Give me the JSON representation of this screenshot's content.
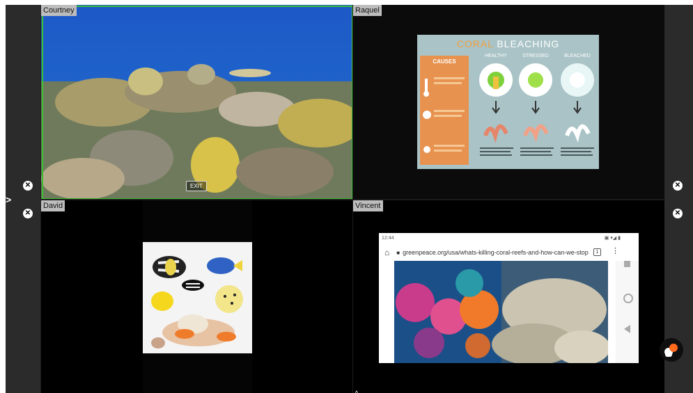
{
  "participants": [
    {
      "name": "Courtney",
      "exit_label": "EXIT"
    },
    {
      "name": "Raquel"
    },
    {
      "name": "David"
    },
    {
      "name": "Vincent"
    }
  ],
  "controls": {
    "close_glyph": "✕",
    "expand_glyph": ">",
    "collapse_glyph": "^"
  },
  "coral_slide": {
    "title_part1": "CORAL",
    "title_part2": "BLEACHING",
    "causes_title": "CAUSES",
    "stages": [
      "HEALTHY",
      "STRESSED",
      "BLEACHED"
    ]
  },
  "browser": {
    "time": "12:44",
    "url": "greenpeace.org/usa/whats-killing-coral-reefs-and-how-can-we-stop",
    "tab_count": "1"
  },
  "colors": {
    "active_speaker": "#3cbf35",
    "slide_bg": "#a9c3c6",
    "causes_bg": "#e89250"
  }
}
